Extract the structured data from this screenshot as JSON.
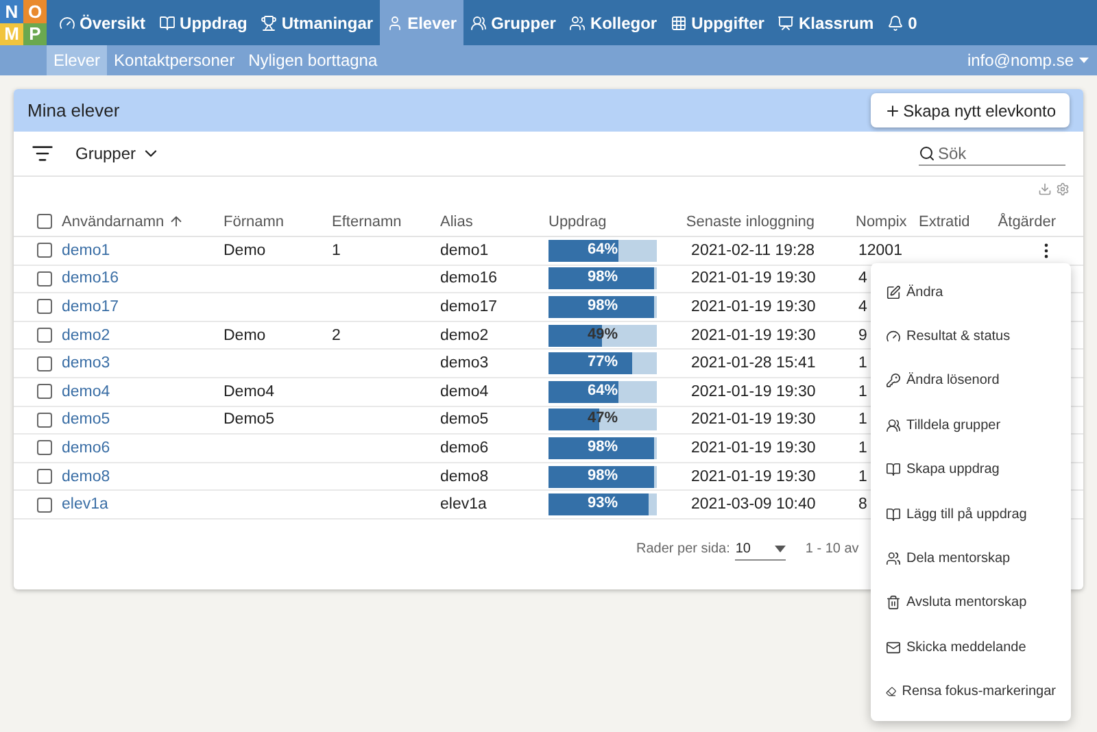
{
  "logo": [
    "N",
    "O",
    "M",
    "P"
  ],
  "nav": [
    {
      "label": "Översikt",
      "selected": false
    },
    {
      "label": "Uppdrag",
      "selected": false
    },
    {
      "label": "Utmaningar",
      "selected": false
    },
    {
      "label": "Elever",
      "selected": true
    },
    {
      "label": "Grupper",
      "selected": false
    },
    {
      "label": "Kollegor",
      "selected": false
    },
    {
      "label": "Uppgifter",
      "selected": false
    },
    {
      "label": "Klassrum",
      "selected": false
    },
    {
      "label": "0",
      "selected": false
    }
  ],
  "subnav": [
    {
      "label": "Elever",
      "selected": true
    },
    {
      "label": "Kontaktpersoner",
      "selected": false
    },
    {
      "label": "Nyligen borttagna",
      "selected": false
    }
  ],
  "account": "info@nomp.se",
  "card_title": "Mina elever",
  "create_button": "Skapa nytt elevkonto",
  "groups_filter": "Grupper",
  "search": {
    "placeholder": "Sök"
  },
  "table": {
    "select_all_checked": false,
    "columns": [
      "Användarnamn",
      "Förnamn",
      "Efternamn",
      "Alias",
      "Uppdrag",
      "Senaste inloggning",
      "Nompix",
      "Extratid",
      "Åtgärder"
    ],
    "rows": [
      {
        "checked": false,
        "username": "demo1",
        "first": "Demo",
        "last": "1",
        "alias": "demo1",
        "progress": "64%",
        "level": 0.64,
        "login": "2021-02-11 19:28",
        "nompix": "12001"
      },
      {
        "checked": false,
        "username": "demo16",
        "first": "",
        "last": "",
        "alias": "demo16",
        "progress": "98%",
        "level": 0.98,
        "login": "2021-01-19 19:30",
        "nompix": "4"
      },
      {
        "checked": false,
        "username": "demo17",
        "first": "",
        "last": "",
        "alias": "demo17",
        "progress": "98%",
        "level": 0.98,
        "login": "2021-01-19 19:30",
        "nompix": "4"
      },
      {
        "checked": false,
        "username": "demo2",
        "first": "Demo",
        "last": "2",
        "alias": "demo2",
        "progress": "49%",
        "level": 0.49,
        "login": "2021-01-19 19:30",
        "nompix": "9"
      },
      {
        "checked": false,
        "username": "demo3",
        "first": "",
        "last": "",
        "alias": "demo3",
        "progress": "77%",
        "level": 0.77,
        "login": "2021-01-28 15:41",
        "nompix": "1"
      },
      {
        "checked": false,
        "username": "demo4",
        "first": "Demo4",
        "last": "",
        "alias": "demo4",
        "progress": "64%",
        "level": 0.64,
        "login": "2021-01-19 19:30",
        "nompix": "1"
      },
      {
        "checked": false,
        "username": "demo5",
        "first": "Demo5",
        "last": "",
        "alias": "demo5",
        "progress": "47%",
        "level": 0.47,
        "login": "2021-01-19 19:30",
        "nompix": "1"
      },
      {
        "checked": false,
        "username": "demo6",
        "first": "",
        "last": "",
        "alias": "demo6",
        "progress": "98%",
        "level": 0.98,
        "login": "2021-01-19 19:30",
        "nompix": "1"
      },
      {
        "checked": false,
        "username": "demo8",
        "first": "",
        "last": "",
        "alias": "demo8",
        "progress": "98%",
        "level": 0.98,
        "login": "2021-01-19 19:30",
        "nompix": "1"
      },
      {
        "checked": false,
        "username": "elev1a",
        "first": "",
        "last": "",
        "alias": "elev1a",
        "progress": "93%",
        "level": 0.93,
        "login": "2021-03-09 10:40",
        "nompix": "8"
      }
    ]
  },
  "pagination": {
    "label": "Rader per sida:",
    "value": "10",
    "range": "1 - 10 av"
  },
  "menu": [
    "Ändra",
    "Resultat & status",
    "Ändra lösenord",
    "Tilldela grupper",
    "Skapa uppdrag",
    "Lägg till på uppdrag",
    "Dela mentorskap",
    "Avsluta mentorskap",
    "Skicka meddelande",
    "Rensa fokus-markeringar"
  ]
}
